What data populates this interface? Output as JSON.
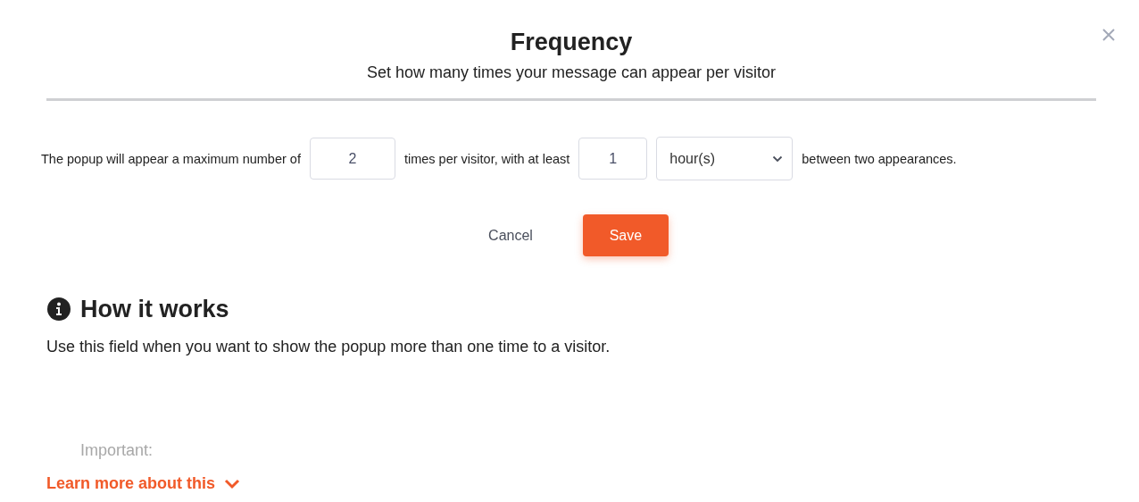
{
  "dialog": {
    "title": "Frequency",
    "subtitle": "Set how many times your message can appear per visitor"
  },
  "rule": {
    "text_1": "The popup will appear a maximum number of",
    "max_times": "2",
    "text_2": "times per visitor, with at least",
    "interval": "1",
    "unit": "hour(s)",
    "text_3": "between two appearances."
  },
  "buttons": [
    {
      "label": "Cancel",
      "kind": "secondary"
    },
    {
      "label": "Save",
      "kind": "primary"
    }
  ],
  "help": {
    "heading": "How it works",
    "body": "Use this field when you want to show the popup more than one time to a visitor.",
    "faded_note": "Important:",
    "link": "Learn more about this",
    "expanded": false
  }
}
